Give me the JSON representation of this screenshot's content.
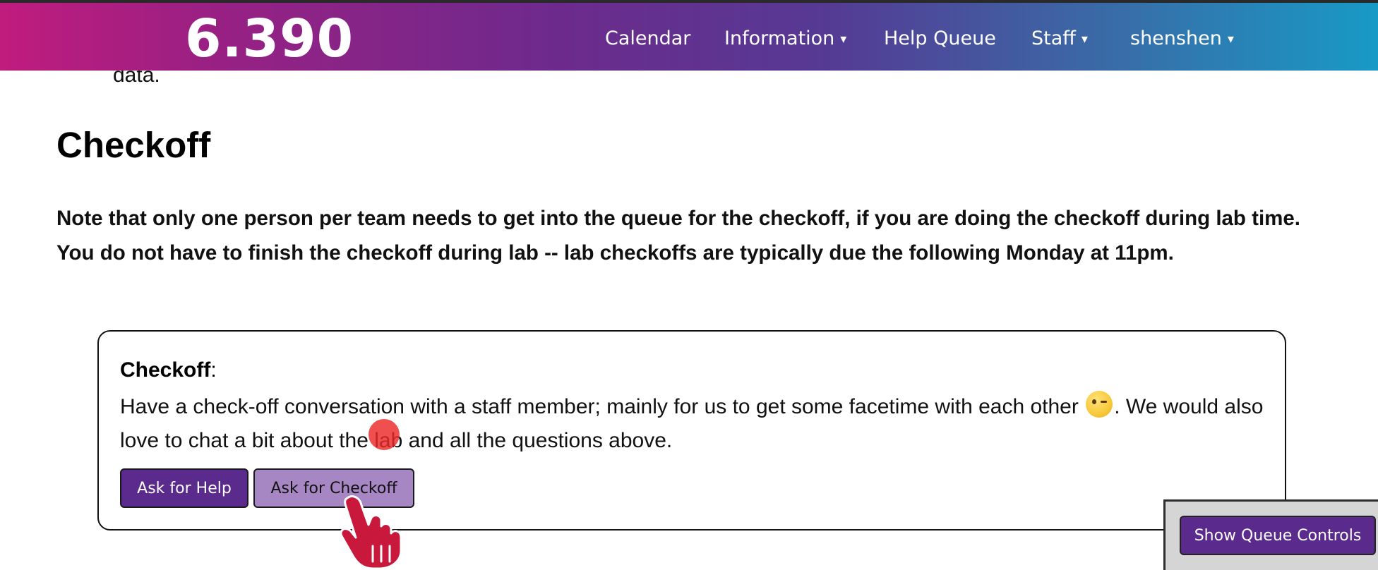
{
  "navbar": {
    "brand": "6.390",
    "items": [
      {
        "label": "Calendar",
        "dropdown": false
      },
      {
        "label": "Information",
        "dropdown": true
      },
      {
        "label": "Help Queue",
        "dropdown": false
      },
      {
        "label": "Staff",
        "dropdown": true
      },
      {
        "label": "shenshen",
        "dropdown": true
      }
    ],
    "caret": "▾"
  },
  "content": {
    "scrolled_text": "data.",
    "section_title": "Checkoff",
    "note": "Note that only one person per team needs to get into the queue for the checkoff, if you are doing the checkoff during lab time. You do not have to finish the checkoff during lab -- lab checkoffs are typically due the following Monday at 11pm."
  },
  "checkoff_card": {
    "title": "Checkoff",
    "title_suffix": ":",
    "text_before_emoji": "Have a check-off conversation with a staff member; mainly for us to get some facetime with each other",
    "text_after_emoji": ". We would also love to chat a bit about the lab and all the questions above.",
    "ask_help_label": "Ask for Help",
    "ask_checkoff_label": "Ask for Checkoff"
  },
  "queue": {
    "show_controls_label": "Show Queue Controls"
  },
  "colors": {
    "accent": "#5a2a8c",
    "checkoff_button": "#a786c4",
    "gradient_start": "#c01c7d",
    "gradient_end": "#189ac6",
    "click_indicator": "#ec2828"
  }
}
